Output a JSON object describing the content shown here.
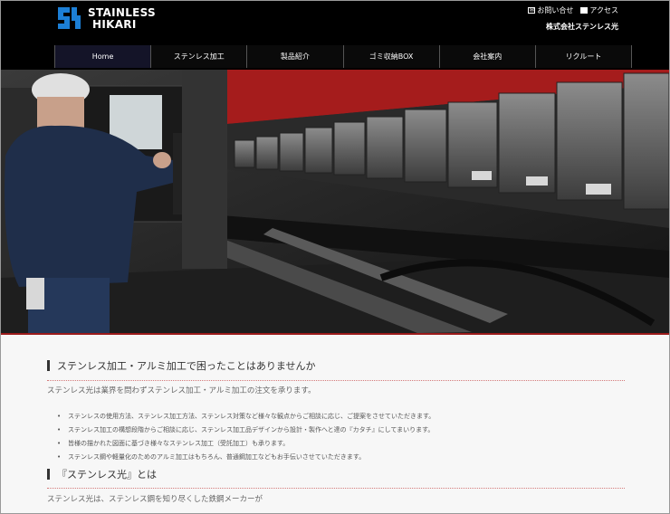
{
  "logo": {
    "line1": "STAINLESS",
    "line2": "HIKARI"
  },
  "util_links": [
    {
      "label": "お問い合せ",
      "icon": "mail-icon"
    },
    {
      "label": "アクセス",
      "icon": "map-icon"
    }
  ],
  "company_name": "株式会社ステンレス光",
  "nav": [
    {
      "label": "Home",
      "active": true
    },
    {
      "label": "ステンレス加工"
    },
    {
      "label": "製品紹介"
    },
    {
      "label": "ゴミ収納BOX"
    },
    {
      "label": "会社案内"
    },
    {
      "label": "リクルート"
    }
  ],
  "slider": {
    "total": 6,
    "active": 1
  },
  "sections": {
    "s1": {
      "title": "ステンレス加工・アルミ加工で困ったことはありませんか",
      "lead": "ステンレス光は業界を問わずステンレス加工・アルミ加工の注文を承ります。",
      "items": [
        "ステンレスの使用方法、ステンレス加工方法、ステンレス対策など様々な観点からご相談に応じ、ご提案をさせていただきます。",
        "ステンレス加工の構想段階からご相談に応じ、ステンレス加工品デザインから設計・製作へと達の『カタチ』にしてまいります。",
        "皆様の描かれた図面に基づき様々なステンレス加工（受託加工）も承ります。",
        "ステンレス鋼や軽量化のためのアルミ加工はもちろん、普通鋼加工などもお手伝いさせていただきます。"
      ]
    },
    "s2": {
      "title": "『ステンレス光』とは",
      "lead": "ステンレス光は、ステンレス鋼を知り尽くした鉄鋼メーカーが"
    }
  },
  "colors": {
    "header_bg": "#000000",
    "accent_red": "#c0261f",
    "logo_blue": "#1c7fd6"
  }
}
